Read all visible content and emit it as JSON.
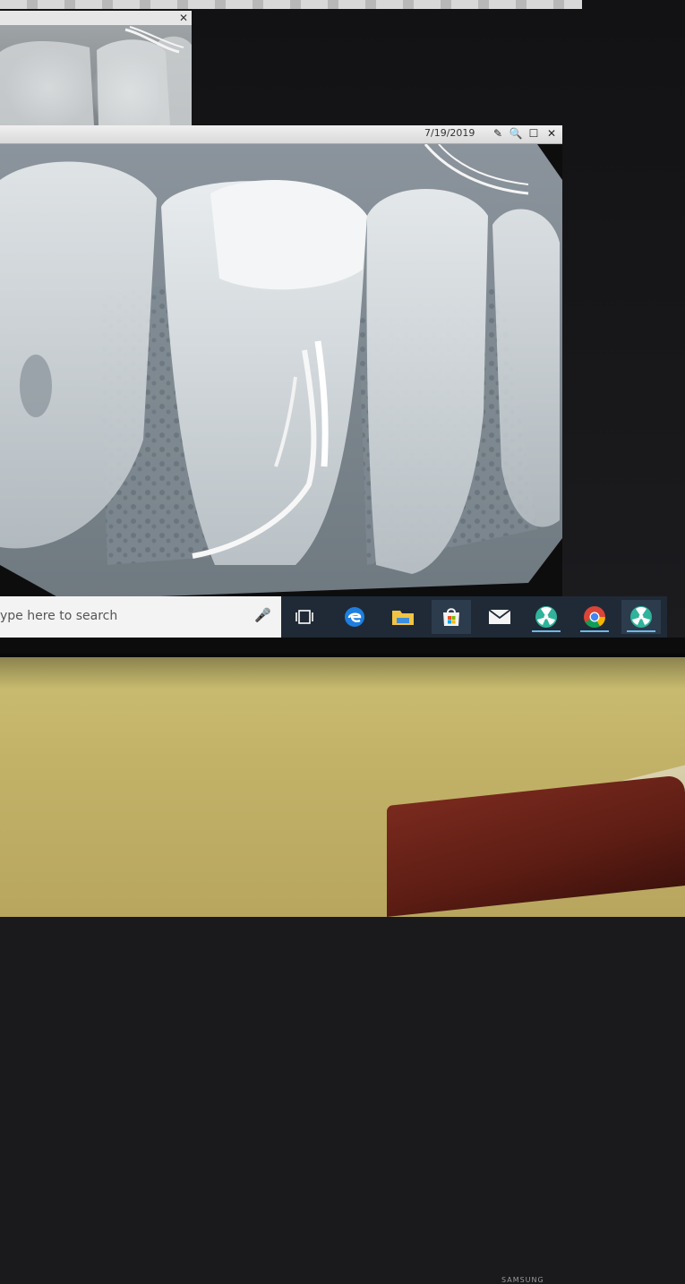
{
  "background_window": {
    "close_label": "✕"
  },
  "xray_window": {
    "date": "7/19/2019",
    "buttons": {
      "edit": "✎",
      "search": "🔍",
      "maximize": "☐",
      "close": "✕"
    }
  },
  "taskbar": {
    "search_placeholder": "ype here to search",
    "apps": [
      {
        "name": "task-view",
        "icon": "task-view-icon"
      },
      {
        "name": "edge",
        "icon": "edge-icon"
      },
      {
        "name": "file-explorer",
        "icon": "folder-icon"
      },
      {
        "name": "store",
        "icon": "store-icon"
      },
      {
        "name": "mail",
        "icon": "mail-icon"
      },
      {
        "name": "xray-app-1",
        "icon": "radiation-icon"
      },
      {
        "name": "chrome",
        "icon": "chrome-icon"
      },
      {
        "name": "xray-app-2",
        "icon": "radiation-icon"
      }
    ]
  },
  "monitor": {
    "brand": "SAMSUNG"
  },
  "colors": {
    "taskbar": "#1f2a36",
    "accent": "#6fb7e8",
    "wall": "#c2b268",
    "chair": "#5d1d14"
  }
}
